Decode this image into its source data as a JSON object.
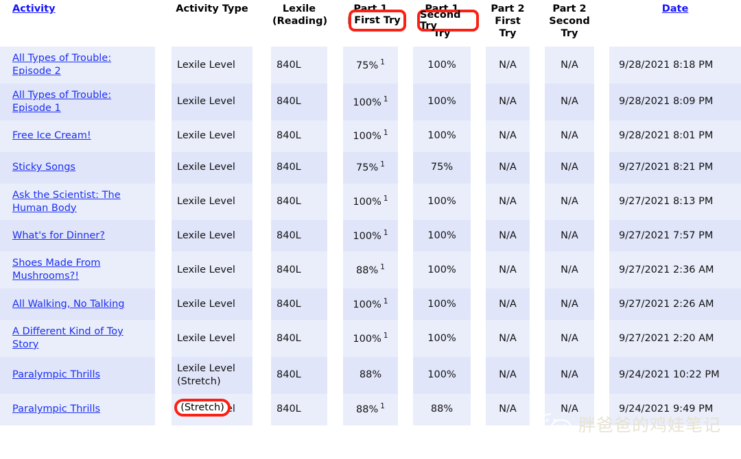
{
  "table": {
    "columns": [
      {
        "key": "activity",
        "label": "Activity",
        "is_link": true,
        "lines": [
          "Activity"
        ]
      },
      {
        "key": "type",
        "label": "Activity Type",
        "is_link": false,
        "lines": [
          "Activity Type"
        ]
      },
      {
        "key": "lexile",
        "label": "Lexile (Reading)",
        "is_link": false,
        "lines": [
          "Lexile",
          "(Reading)"
        ]
      },
      {
        "key": "p1first",
        "label": "Part 1 First Try",
        "is_link": false,
        "lines": [
          "Part 1",
          "First Try"
        ]
      },
      {
        "key": "p1second",
        "label": "Part 1 Second Try",
        "is_link": false,
        "lines": [
          "Part 1",
          "Second Try"
        ]
      },
      {
        "key": "p2first",
        "label": "Part 2 First Try",
        "is_link": false,
        "lines": [
          "Part 2",
          "First",
          "Try"
        ]
      },
      {
        "key": "p2second",
        "label": "Part 2 Second Try",
        "is_link": false,
        "lines": [
          "Part 2",
          "Second",
          "Try"
        ]
      },
      {
        "key": "date",
        "label": "Date",
        "is_link": true,
        "lines": [
          "Date"
        ]
      }
    ],
    "header": {
      "activity": "Activity",
      "activity_type": "Activity Type",
      "lexile_l1": "Lexile",
      "lexile_l2": "(Reading)",
      "p1_l1": "Part 1",
      "p1_first_try": "First Try",
      "p1b_l1": "Part 1",
      "p1_second_try": "Second Try",
      "p2_l1": "Part 2",
      "p2_l2": "First",
      "p2_l3": "Try",
      "p2b_l1": "Part 2",
      "p2b_l2": "Second",
      "p2b_l3": "Try",
      "date": "Date"
    },
    "rows": [
      {
        "activity": "All Types of Trouble: Episode 2",
        "type": "Lexile Level",
        "type_note": "",
        "lexile": "840L",
        "p1_first": "75%",
        "p1_first_footnote": "1",
        "p1_second": "100%",
        "p2_first": "N/A",
        "p2_second": "N/A",
        "date": "9/28/2021  8:18 PM"
      },
      {
        "activity": "All Types of Trouble: Episode 1",
        "type": "Lexile Level",
        "type_note": "",
        "lexile": "840L",
        "p1_first": "100%",
        "p1_first_footnote": "1",
        "p1_second": "100%",
        "p2_first": "N/A",
        "p2_second": "N/A",
        "date": "9/28/2021  8:09 PM"
      },
      {
        "activity": "Free Ice Cream!",
        "type": "Lexile Level",
        "type_note": "",
        "lexile": "840L",
        "p1_first": "100%",
        "p1_first_footnote": "1",
        "p1_second": "100%",
        "p2_first": "N/A",
        "p2_second": "N/A",
        "date": "9/28/2021  8:01 PM"
      },
      {
        "activity": "Sticky Songs",
        "type": "Lexile Level",
        "type_note": "",
        "lexile": "840L",
        "p1_first": "75%",
        "p1_first_footnote": "1",
        "p1_second": "75%",
        "p2_first": "N/A",
        "p2_second": "N/A",
        "date": "9/27/2021  8:21 PM"
      },
      {
        "activity": "Ask the Scientist: The Human Body",
        "type": "Lexile Level",
        "type_note": "",
        "lexile": "840L",
        "p1_first": "100%",
        "p1_first_footnote": "1",
        "p1_second": "100%",
        "p2_first": "N/A",
        "p2_second": "N/A",
        "date": "9/27/2021  8:13 PM"
      },
      {
        "activity": "What's for Dinner?",
        "type": "Lexile Level",
        "type_note": "",
        "lexile": "840L",
        "p1_first": "100%",
        "p1_first_footnote": "1",
        "p1_second": "100%",
        "p2_first": "N/A",
        "p2_second": "N/A",
        "date": "9/27/2021  7:57 PM"
      },
      {
        "activity": "Shoes Made From Mushrooms?!",
        "type": "Lexile Level",
        "type_note": "",
        "lexile": "840L",
        "p1_first": "88%",
        "p1_first_footnote": "1",
        "p1_second": "100%",
        "p2_first": "N/A",
        "p2_second": "N/A",
        "date": "9/27/2021  2:36 AM"
      },
      {
        "activity": "All Walking, No Talking",
        "type": "Lexile Level",
        "type_note": "",
        "lexile": "840L",
        "p1_first": "100%",
        "p1_first_footnote": "1",
        "p1_second": "100%",
        "p2_first": "N/A",
        "p2_second": "N/A",
        "date": "9/27/2021  2:26 AM"
      },
      {
        "activity": "A Different Kind of Toy Story",
        "type": "Lexile Level",
        "type_note": "",
        "lexile": "840L",
        "p1_first": "100%",
        "p1_first_footnote": "1",
        "p1_second": "100%",
        "p2_first": "N/A",
        "p2_second": "N/A",
        "date": "9/27/2021  2:20 AM"
      },
      {
        "activity": "Paralympic Thrills",
        "type": "Lexile Level",
        "type_note": "(Stretch)",
        "lexile": "840L",
        "p1_first": "88%",
        "p1_first_footnote": "",
        "p1_second": "100%",
        "p2_first": "N/A",
        "p2_second": "N/A",
        "date": "9/24/2021  10:22 PM"
      },
      {
        "activity": "Paralympic Thrills",
        "type": "Lexile Level",
        "type_note": "",
        "lexile": "840L",
        "p1_first": "88%",
        "p1_first_footnote": "1",
        "p1_second": "88%",
        "p2_first": "N/A",
        "p2_second": "N/A",
        "date": "9/24/2021  9:49 PM"
      }
    ]
  },
  "annotations": {
    "color": "#fb1f14",
    "first_try": "First Try",
    "second_try": "Second Try",
    "stretch": "(Stretch)"
  },
  "watermark": {
    "text": "胖爸爸的鸡娃笔记",
    "icon": "wechat-icon",
    "color": "#e7e1cf"
  },
  "colors": {
    "row_odd": "#eaeefb",
    "row_even": "#e1e5f9",
    "link": "#1b2ff0",
    "header_link": "#1414ff",
    "annotation_red": "#fb1f14",
    "page_background": "#ffffff"
  }
}
